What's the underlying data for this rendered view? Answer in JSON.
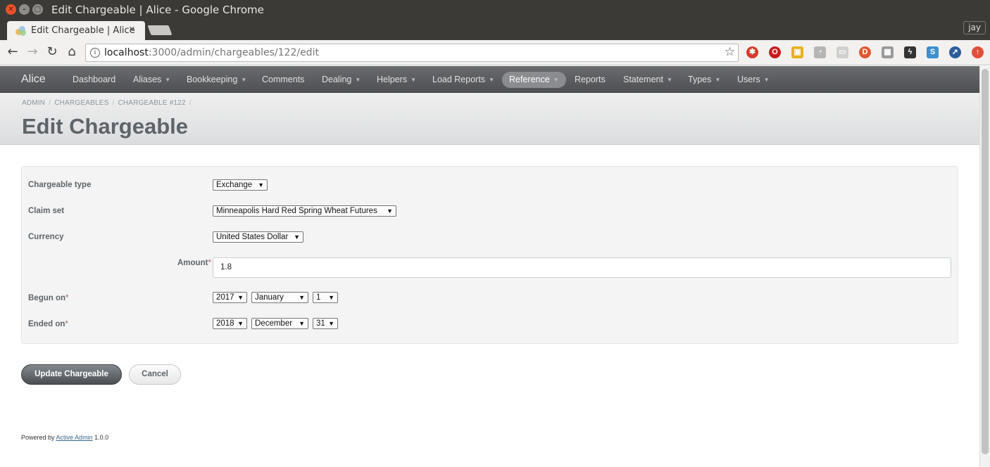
{
  "window": {
    "title": "Edit Chargeable | Alice - Google Chrome"
  },
  "tab": {
    "title": "Edit Chargeable | Alice",
    "close": "×"
  },
  "profile": "jay",
  "omnibox": {
    "host": "localhost",
    "path": ":3000/admin/chargeables/122/edit"
  },
  "header": {
    "site_title": "Alice",
    "nav": [
      {
        "label": "Dashboard",
        "dropdown": false
      },
      {
        "label": "Aliases",
        "dropdown": true
      },
      {
        "label": "Bookkeeping",
        "dropdown": true
      },
      {
        "label": "Comments",
        "dropdown": false
      },
      {
        "label": "Dealing",
        "dropdown": true
      },
      {
        "label": "Helpers",
        "dropdown": true
      },
      {
        "label": "Load Reports",
        "dropdown": true
      },
      {
        "label": "Reference",
        "dropdown": true,
        "current": true
      },
      {
        "label": "Reports",
        "dropdown": false
      },
      {
        "label": "Statement",
        "dropdown": true
      },
      {
        "label": "Types",
        "dropdown": true
      },
      {
        "label": "Users",
        "dropdown": true
      }
    ]
  },
  "breadcrumbs": [
    "ADMIN",
    "CHARGEABLES",
    "CHARGEABLE #122"
  ],
  "page_title": "Edit Chargeable",
  "form": {
    "chargeable_type": {
      "label": "Chargeable type",
      "value": "Exchange"
    },
    "claim_set": {
      "label": "Claim set",
      "value": "Minneapolis Hard Red Spring Wheat Futures"
    },
    "currency": {
      "label": "Currency",
      "value": "United States Dollar"
    },
    "amount": {
      "label": "Amount",
      "value": "1.8",
      "required_mark": "*"
    },
    "begun_on": {
      "label": "Begun on",
      "required_mark": "*",
      "year": "2017",
      "month": "January",
      "day": "1"
    },
    "ended_on": {
      "label": "Ended on",
      "required_mark": "*",
      "year": "2018",
      "month": "December",
      "day": "31"
    }
  },
  "actions": {
    "submit": "Update Chargeable",
    "cancel": "Cancel"
  },
  "footer": {
    "prefix": "Powered by",
    "link": "Active Admin",
    "version": "1.0.0"
  },
  "icons": {
    "caret": "▼",
    "nav_caret": "▼"
  },
  "colors": {
    "header_bg": "#55575a",
    "title_text": "#5e6469",
    "link": "#38678b",
    "required": "#aa6666"
  }
}
